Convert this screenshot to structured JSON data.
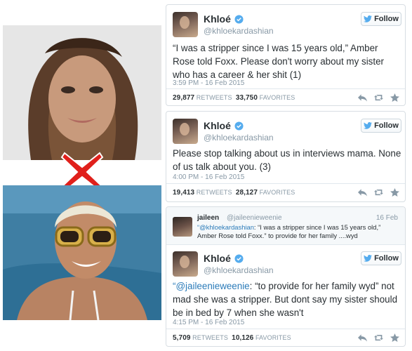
{
  "photos": {
    "top_label": "Khloé Kardashian photo",
    "bottom_label": "Amber Rose photo"
  },
  "separator": "X",
  "tweets": [
    {
      "name": "Khloé",
      "handle": "@khloekardashian",
      "follow_label": "Follow",
      "text": "“I was a stripper since I was 15 years old,” Amber Rose told Foxx. Please don't worry about my sister who has a career & her shit (1)",
      "time": "3:59 PM - 16 Feb 2015",
      "retweets": "29,877",
      "retweets_label": "RETWEETS",
      "favorites": "33,750",
      "favorites_label": "FAVORITES"
    },
    {
      "name": "Khloé",
      "handle": "@khloekardashian",
      "follow_label": "Follow",
      "text": "Please stop talking about us in interviews mama. None of us talk about you. (3)",
      "time": "4:00 PM - 16 Feb 2015",
      "retweets": "19,413",
      "retweets_label": "RETWEETS",
      "favorites": "28,127",
      "favorites_label": "FAVORITES"
    },
    {
      "name": "Khloé",
      "handle": "@khloekardashian",
      "follow_label": "Follow",
      "text_mention": "“@jaileenieweenie",
      "text_rest": ": “to provide for her family wyd” not mad she was a stripper. But dont say my sister should be in bed by 7 when she wasn't",
      "time": "4:15 PM - 16 Feb 2015",
      "retweets": "5,709",
      "retweets_label": "RETWEETS",
      "favorites": "10,126",
      "favorites_label": "FAVORITES"
    }
  ],
  "quoted": {
    "name": "jaileen",
    "handle": "@jaileenieweenie",
    "date": "16 Feb",
    "mention": "“@khloekardashian",
    "text": ": “I was a stripper since I was 15 years old,” Amber Rose told Foxx.” to provide for her family ....wyd"
  },
  "colors": {
    "link": "#2b7bb9",
    "verified": "#55acee",
    "separator": "#e0201b"
  },
  "icons": [
    "verified-badge-icon",
    "twitter-bird-icon",
    "reply-icon",
    "retweet-icon",
    "favorite-star-icon"
  ]
}
